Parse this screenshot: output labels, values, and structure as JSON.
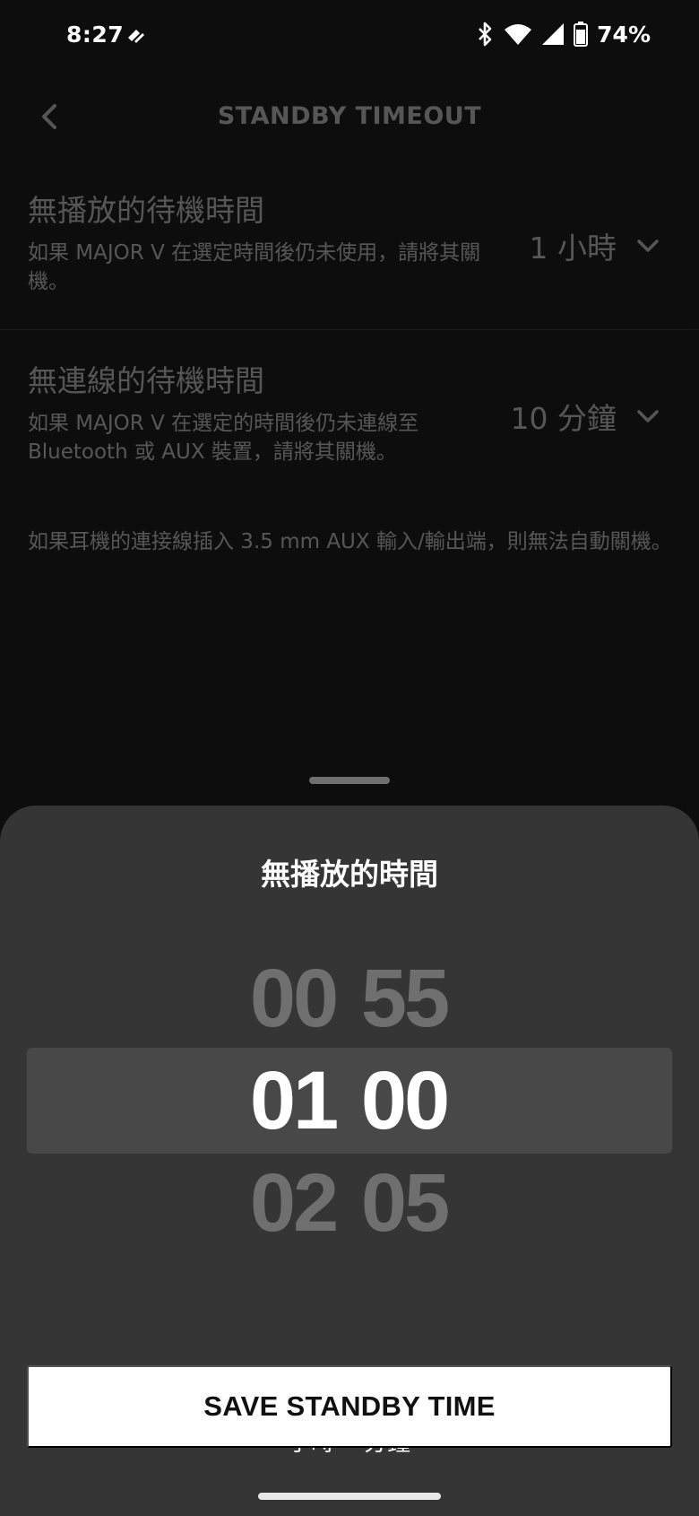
{
  "status_bar": {
    "time": "8:27",
    "battery": "74%",
    "icons": [
      "app-notification-icon",
      "bluetooth-icon",
      "wifi-icon",
      "cellular-signal-icon",
      "battery-icon"
    ]
  },
  "header": {
    "title": "STANDBY TIMEOUT",
    "back_icon": "chevron-left-icon"
  },
  "settings": {
    "no_playback": {
      "title": "無播放的待機時間",
      "description": "如果 MAJOR V 在選定時間後仍未使用，請將其關機。",
      "value": "1 小時"
    },
    "no_connection": {
      "title": "無連線的待機時間",
      "description": "如果 MAJOR V 在選定的時間後仍未連線至 Bluetooth 或 AUX 裝置，請將其關機。",
      "value": "10 分鐘"
    },
    "footnote": "如果耳機的連接線插入 3.5 mm AUX 輸入/輸出端，則無法自動關機。"
  },
  "sheet": {
    "title": "無播放的時間",
    "picker": {
      "hours": [
        "00",
        "01",
        "02"
      ],
      "minutes": [
        "55",
        "00",
        "05"
      ],
      "selected_hours": "01",
      "selected_minutes": "00"
    },
    "hours_label": "小時",
    "minutes_label": "分鐘",
    "save_label": "SAVE STANDBY TIME"
  },
  "colors": {
    "background": "#0d0d0d",
    "sheet": "#353535",
    "selection_band": "#484848",
    "button": "#ffffff"
  }
}
